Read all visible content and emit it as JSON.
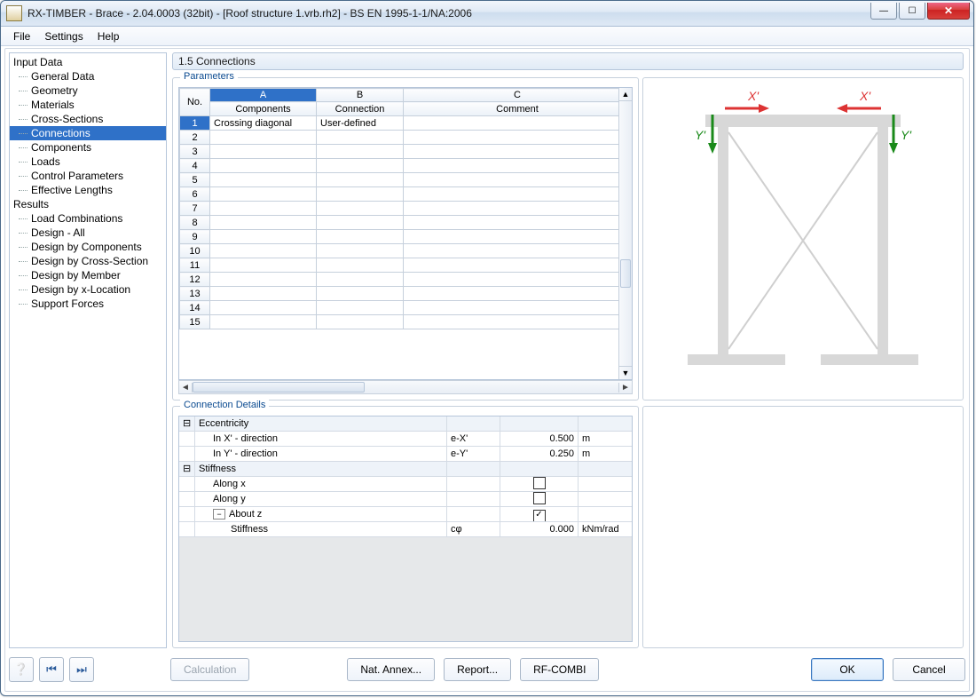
{
  "window": {
    "title": "RX-TIMBER - Brace - 2.04.0003 (32bit) - [Roof structure 1.vrb.rh2] - BS EN 1995-1-1/NA:2006"
  },
  "menu": {
    "file": "File",
    "settings": "Settings",
    "help": "Help"
  },
  "sidebar": {
    "input_data": "Input Data",
    "general_data": "General Data",
    "geometry": "Geometry",
    "materials": "Materials",
    "cross_sections": "Cross-Sections",
    "connections": "Connections",
    "components": "Components",
    "loads": "Loads",
    "control_parameters": "Control Parameters",
    "effective_lengths": "Effective Lengths",
    "results": "Results",
    "load_combinations": "Load Combinations",
    "design_all": "Design - All",
    "design_by_components": "Design by Components",
    "design_by_cross_section": "Design by Cross-Section",
    "design_by_member": "Design by Member",
    "design_by_x_location": "Design by x-Location",
    "support_forces": "Support Forces"
  },
  "content_title": "1.5 Connections",
  "parameters": {
    "legend": "Parameters",
    "letters": {
      "a": "A",
      "b": "B",
      "c": "C"
    },
    "headers": {
      "no": "No.",
      "components": "Components",
      "connection": "Connection",
      "comment": "Comment"
    },
    "rows": [
      {
        "no": "1",
        "a": "Crossing diagonal",
        "b": "User-defined",
        "c": ""
      },
      {
        "no": "2",
        "a": "",
        "b": "",
        "c": ""
      },
      {
        "no": "3",
        "a": "",
        "b": "",
        "c": ""
      },
      {
        "no": "4",
        "a": "",
        "b": "",
        "c": ""
      },
      {
        "no": "5",
        "a": "",
        "b": "",
        "c": ""
      },
      {
        "no": "6",
        "a": "",
        "b": "",
        "c": ""
      },
      {
        "no": "7",
        "a": "",
        "b": "",
        "c": ""
      },
      {
        "no": "8",
        "a": "",
        "b": "",
        "c": ""
      },
      {
        "no": "9",
        "a": "",
        "b": "",
        "c": ""
      },
      {
        "no": "10",
        "a": "",
        "b": "",
        "c": ""
      },
      {
        "no": "11",
        "a": "",
        "b": "",
        "c": ""
      },
      {
        "no": "12",
        "a": "",
        "b": "",
        "c": ""
      },
      {
        "no": "13",
        "a": "",
        "b": "",
        "c": ""
      },
      {
        "no": "14",
        "a": "",
        "b": "",
        "c": ""
      },
      {
        "no": "15",
        "a": "",
        "b": "",
        "c": ""
      }
    ]
  },
  "details": {
    "legend": "Connection Details",
    "eccentricity": "Eccentricity",
    "in_x": "In X' - direction",
    "ex_sym": "e-X'",
    "ex_val": "0.500",
    "ex_unit": "m",
    "in_y": "In Y' - direction",
    "ey_sym": "e-Y'",
    "ey_val": "0.250",
    "ey_unit": "m",
    "stiffness": "Stiffness",
    "along_x": "Along x",
    "along_y": "Along y",
    "about_z": "About z",
    "stiff_label": "Stiffness",
    "stiff_sym": "cφ",
    "stiff_val": "0.000",
    "stiff_unit": "kNm/rad"
  },
  "buttons": {
    "calculation": "Calculation",
    "nat_annex": "Nat. Annex...",
    "report": "Report...",
    "rf_combi": "RF-COMBI",
    "ok": "OK",
    "cancel": "Cancel"
  },
  "preview": {
    "x_label": "X'",
    "y_label": "Y'"
  }
}
